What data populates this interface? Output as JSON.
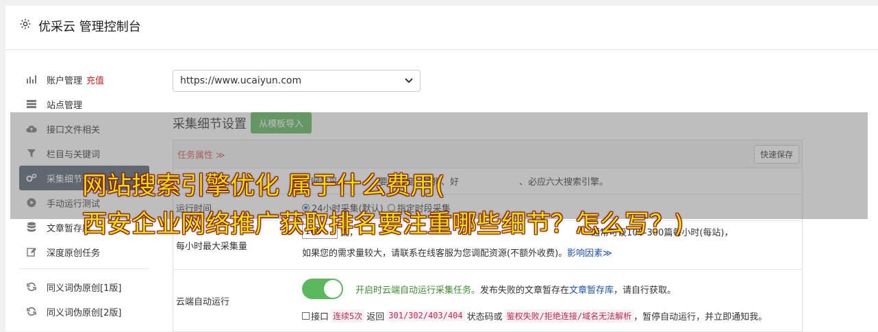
{
  "header": {
    "title": "优采云 管理控制台",
    "icon": "gear-icon"
  },
  "sidebar": {
    "items": [
      {
        "label": "账户管理",
        "badge": "充值",
        "icon": "bar-chart-icon"
      },
      {
        "label": "站点管理",
        "icon": "server-icon"
      },
      {
        "label": "接口文件相关",
        "icon": "cloud-upload-icon"
      },
      {
        "label": "栏目与关键词",
        "icon": "filter-icon"
      },
      {
        "label": "采集细节设置",
        "icon": "gears-icon",
        "active": true
      },
      {
        "label": "手动运行测试",
        "icon": "play-circle-icon"
      },
      {
        "label": "文章暂存库",
        "icon": "database-icon"
      },
      {
        "label": "深度原创任务",
        "icon": "edit-icon"
      }
    ],
    "items2": [
      {
        "label": "同义词伪原创[1版]",
        "icon": "refresh-icon"
      },
      {
        "label": "同义词伪原创[2版]",
        "icon": "refresh-icon"
      }
    ]
  },
  "main": {
    "site_select": "https://www.ucaiyun.com",
    "section_title": "采集细节设置",
    "import_button": "从模板导入",
    "panel_tab": "任务属性 ≫",
    "quick_save": "快速保存",
    "row_search": {
      "text_a": "网站采",
      "text_b": "要去百度、搜狗、好",
      "text_c": "、必应六大搜索引擎。"
    },
    "row_runtime": {
      "label": "运行时间",
      "opt1": "24小时采集(默认)",
      "opt2": "指定时段采集"
    },
    "row_rate": {
      "label": "每小时最大采集量",
      "value": "100",
      "text1": "篇，",
      "text2": "通常可设100-300篇每小时(每站)，",
      "text3": "如果您的需求量较大，请联系在线客服为您调配资源(不额外收费)。",
      "link": "影响因素≫"
    },
    "row_cloud": {
      "label": "云端自动运行",
      "desc_green": "开启时云端自动运行采集任务。",
      "desc1": "发布失败的文章暂存在",
      "desc_link": "文章暂存库",
      "desc2": "，请自行获取。",
      "cb_prefix": "接口",
      "code1": "连续5次",
      "t1": "返回",
      "code2": "301/302/403/404",
      "t2": "状态码或",
      "code3": "鉴权失败/拒绝连接/域名无法解析",
      "t3": "，暂停自动运行，并立即通知我。"
    }
  },
  "overlay": {
    "line1": "网站搜索引擎优化 属于什么费用(",
    "line2": "西安企业网络推广获取排名要注重哪些细节？怎么写？)"
  },
  "colors": {
    "accent_green": "#5cb85c",
    "sidebar_active": "#55616f",
    "overlay_text": "#e4e000",
    "red": "#e02020"
  }
}
